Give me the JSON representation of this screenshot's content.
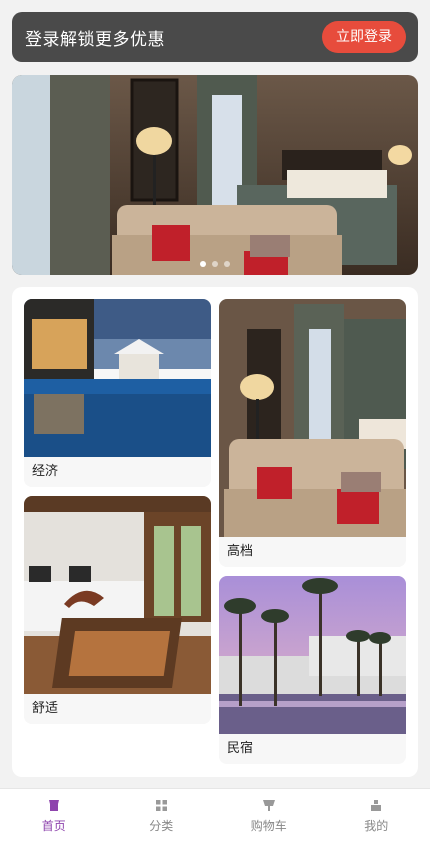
{
  "login_banner": {
    "promo_text": "登录解锁更多优惠",
    "login_button": "立即登录"
  },
  "carousel": {
    "slide_count": 3,
    "active_index": 0
  },
  "categories": [
    {
      "label": "经济"
    },
    {
      "label": "高档"
    },
    {
      "label": "舒适"
    },
    {
      "label": "民宿"
    }
  ],
  "tabbar": {
    "items": [
      {
        "label": "首页",
        "icon": "home-icon",
        "active": true
      },
      {
        "label": "分类",
        "icon": "grid-icon",
        "active": false
      },
      {
        "label": "购物车",
        "icon": "cart-icon",
        "active": false
      },
      {
        "label": "我的",
        "icon": "user-icon",
        "active": false
      }
    ],
    "active_color": "#8e44ad"
  },
  "colors": {
    "login_button": "#e74c3c",
    "banner_bg": "#4a4a4a"
  }
}
